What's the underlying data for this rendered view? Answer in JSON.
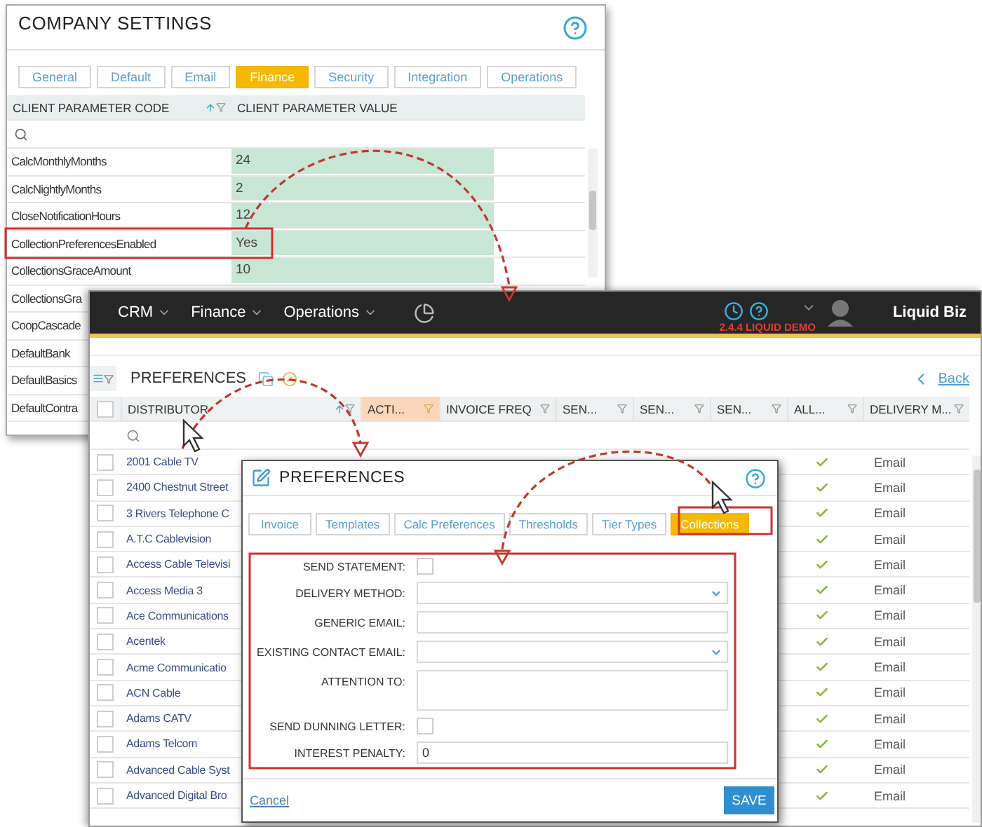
{
  "company_settings": {
    "title": "COMPANY SETTINGS",
    "tabs": [
      {
        "label": "General",
        "selected": false
      },
      {
        "label": "Default",
        "selected": false
      },
      {
        "label": "Email",
        "selected": false
      },
      {
        "label": "Finance",
        "selected": true
      },
      {
        "label": "Security",
        "selected": false
      },
      {
        "label": "Integration",
        "selected": false
      },
      {
        "label": "Operations",
        "selected": false
      }
    ],
    "columns": [
      "CLIENT PARAMETER CODE",
      "CLIENT PARAMETER VALUE"
    ],
    "rows": [
      {
        "code": "CalcMonthlyMonths",
        "value": "24"
      },
      {
        "code": "CalcNightlyMonths",
        "value": "2"
      },
      {
        "code": "CloseNotificationHours",
        "value": "12"
      },
      {
        "code": "CollectionPreferencesEnabled",
        "value": "Yes"
      },
      {
        "code": "CollectionsGraceAmount",
        "value": "10"
      },
      {
        "code": "CollectionsGra"
      },
      {
        "code": "CoopCascade"
      },
      {
        "code": "DefaultBank"
      },
      {
        "code": "DefaultBasics"
      },
      {
        "code": "DefaultContra"
      }
    ]
  },
  "app": {
    "menu": [
      "CRM",
      "Finance",
      "Operations"
    ],
    "version": "2.4.4 LIQUID DEMO",
    "user": "Liquid Biz",
    "page_title": "PREFERENCES",
    "back": "Back",
    "columns": [
      {
        "label": "DISTRIBUTOR",
        "sorted": true,
        "filtered": false
      },
      {
        "label": "ACTI...",
        "sorted": false,
        "filtered": true
      },
      {
        "label": "INVOICE FREQ",
        "sorted": false,
        "filtered": false
      },
      {
        "label": "SEN...",
        "sorted": false,
        "filtered": false
      },
      {
        "label": "SEN...",
        "sorted": false,
        "filtered": false
      },
      {
        "label": "SEN...",
        "sorted": false,
        "filtered": false
      },
      {
        "label": "ALL...",
        "sorted": false,
        "filtered": false
      },
      {
        "label": "DELIVERY M...",
        "sorted": false,
        "filtered": false
      }
    ],
    "all_checked": false,
    "rows": [
      {
        "distributor": "2001 Cable TV",
        "checked": false,
        "all": true,
        "delivery": "Email"
      },
      {
        "distributor": "2400 Chestnut Street",
        "checked": false,
        "all": true,
        "delivery": "Email"
      },
      {
        "distributor": "3 Rivers Telephone C",
        "checked": false,
        "all": true,
        "delivery": "Email"
      },
      {
        "distributor": "A.T.C Cablevision",
        "checked": false,
        "all": true,
        "delivery": "Email"
      },
      {
        "distributor": "Access Cable Televisi",
        "checked": false,
        "all": true,
        "delivery": "Email"
      },
      {
        "distributor": "Access Media 3",
        "checked": false,
        "all": true,
        "delivery": "Email"
      },
      {
        "distributor": "Ace Communications",
        "checked": false,
        "all": true,
        "delivery": "Email"
      },
      {
        "distributor": "Acentek",
        "checked": false,
        "all": true,
        "delivery": "Email"
      },
      {
        "distributor": "Acme Communicatio",
        "checked": false,
        "all": true,
        "delivery": "Email"
      },
      {
        "distributor": "ACN Cable",
        "checked": false,
        "all": true,
        "delivery": "Email"
      },
      {
        "distributor": "Adams CATV",
        "checked": false,
        "all": true,
        "delivery": "Email"
      },
      {
        "distributor": "Adams Telcom",
        "checked": false,
        "all": true,
        "delivery": "Email"
      },
      {
        "distributor": "Advanced Cable Syst",
        "checked": false,
        "all": true,
        "delivery": "Email"
      },
      {
        "distributor": "Advanced Digital Bro",
        "checked": false,
        "all": true,
        "delivery": "Email"
      }
    ]
  },
  "preferences_dialog": {
    "title": "PREFERENCES",
    "tabs": [
      {
        "label": "Invoice",
        "selected": false
      },
      {
        "label": "Templates",
        "selected": false
      },
      {
        "label": "Calc Preferences",
        "selected": false
      },
      {
        "label": "Thresholds",
        "selected": false
      },
      {
        "label": "Tier Types",
        "selected": false
      },
      {
        "label": "Collections",
        "selected": true
      }
    ],
    "fields": [
      {
        "kind": "checkbox",
        "label": "SEND STATEMENT:",
        "checked": false
      },
      {
        "kind": "select",
        "label": "DELIVERY METHOD:"
      },
      {
        "kind": "text",
        "label": "GENERIC EMAIL:"
      },
      {
        "kind": "select",
        "label": "EXISTING CONTACT EMAIL:"
      },
      {
        "kind": "textarea",
        "label": "ATTENTION TO:"
      },
      {
        "kind": "checkbox",
        "label": "SEND DUNNING LETTER:",
        "checked": false
      },
      {
        "kind": "text",
        "label": "INTEREST PENALTY:",
        "value": "0"
      }
    ],
    "cancel": "Cancel",
    "save": "SAVE"
  }
}
